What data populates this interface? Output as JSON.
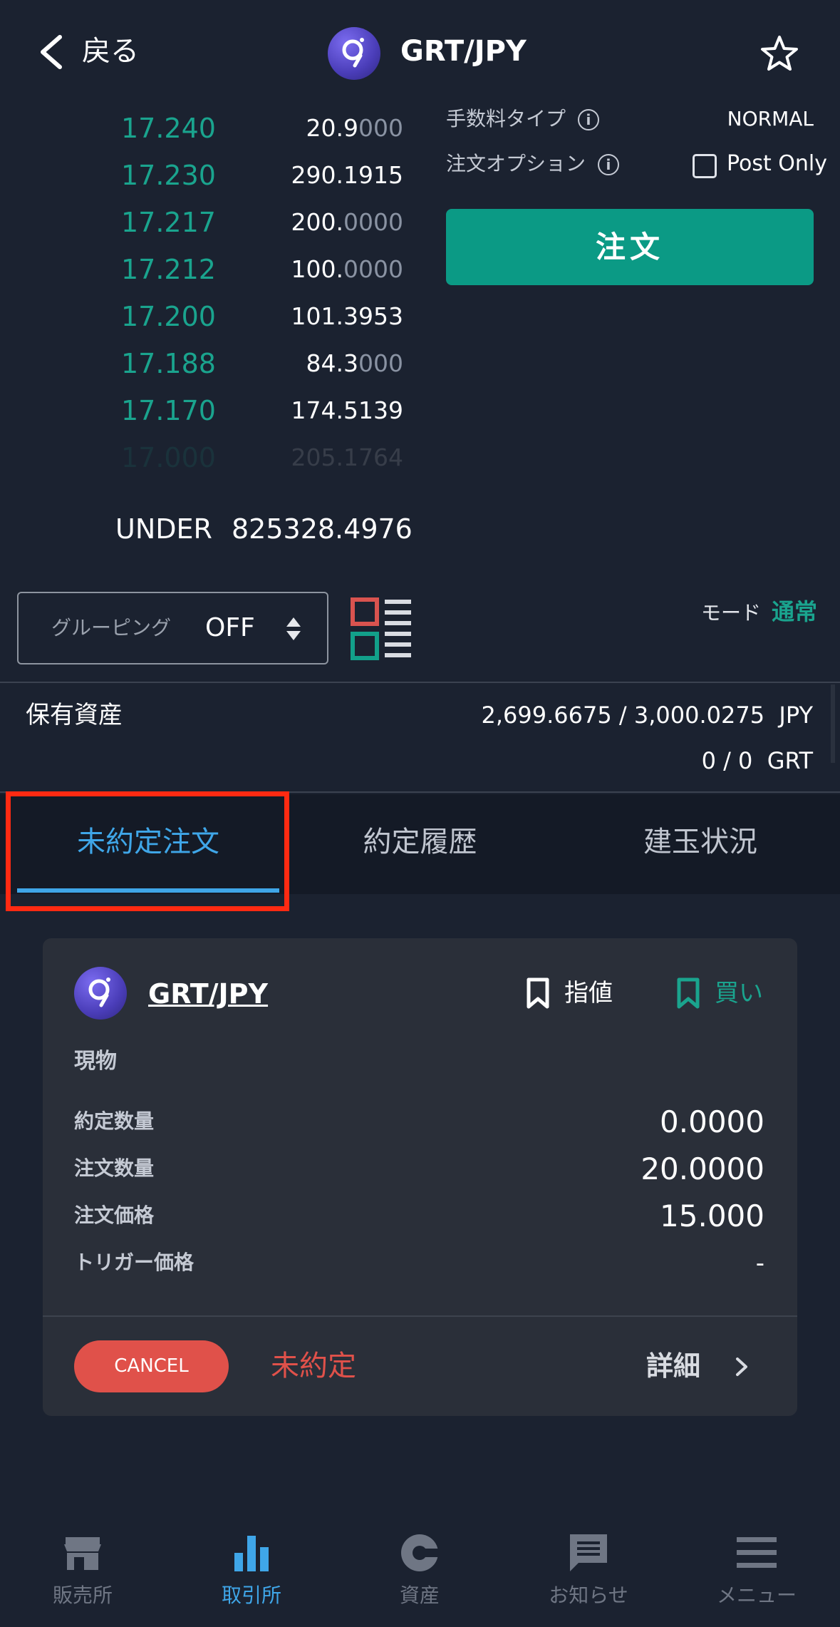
{
  "header": {
    "back_label": "戻る",
    "pair_title": "GRT/JPY"
  },
  "order_book": {
    "rows": [
      {
        "price": "17.240",
        "qty_main": "20.9",
        "qty_dim": "000"
      },
      {
        "price": "17.230",
        "qty_main": "290.1915",
        "qty_dim": ""
      },
      {
        "price": "17.217",
        "qty_main": "200.",
        "qty_dim": "0000"
      },
      {
        "price": "17.212",
        "qty_main": "100.",
        "qty_dim": "0000"
      },
      {
        "price": "17.200",
        "qty_main": "101.3953",
        "qty_dim": ""
      },
      {
        "price": "17.188",
        "qty_main": "84.3",
        "qty_dim": "000"
      },
      {
        "price": "17.170",
        "qty_main": "174.5139",
        "qty_dim": ""
      },
      {
        "price": "17.000",
        "qty_main": "205.1764",
        "qty_dim": ""
      }
    ],
    "under_label": "UNDER",
    "under_value": "825328.4976"
  },
  "order_panel": {
    "fee_type_label": "手数料タイプ",
    "fee_type_value": "NORMAL",
    "order_option_label": "注文オプション",
    "post_only_label": "Post Only",
    "post_only_checked": false,
    "order_button_label": "注文",
    "info_glyph": "i"
  },
  "grouping": {
    "label": "グルーピング",
    "value": "OFF"
  },
  "mode": {
    "label": "モード",
    "value": "通常"
  },
  "assets": {
    "label": "保有資産",
    "jpy_line": "2,699.6675 / 3,000.0275  JPY",
    "grt_line": "0 / 0  GRT"
  },
  "tabs": [
    {
      "label": "未約定注文",
      "active": true
    },
    {
      "label": "約定履歴",
      "active": false
    },
    {
      "label": "建玉状況",
      "active": false
    }
  ],
  "order_card": {
    "pair": "GRT/JPY",
    "order_type": "指値",
    "side": "買い",
    "category": "現物",
    "fields": [
      {
        "label": "約定数量",
        "value": "0.0000"
      },
      {
        "label": "注文数量",
        "value": "20.0000"
      },
      {
        "label": "注文価格",
        "value": "15.000"
      },
      {
        "label": "トリガー価格",
        "value": "-"
      }
    ],
    "cancel_label": "CANCEL",
    "status": "未約定",
    "detail_label": "詳細"
  },
  "bottom_nav": [
    {
      "label": "販売所",
      "icon": "store-icon",
      "active": false
    },
    {
      "label": "取引所",
      "icon": "bar-chart-icon",
      "active": true
    },
    {
      "label": "資産",
      "icon": "pie-chart-icon",
      "active": false
    },
    {
      "label": "お知らせ",
      "icon": "message-icon",
      "active": false
    },
    {
      "label": "メニュー",
      "icon": "menu-icon",
      "active": false
    }
  ],
  "colors": {
    "background": "#1b2230",
    "accent_green": "#1aa48e",
    "accent_blue": "#3fa6e8",
    "cancel_red": "#e0514a",
    "highlight_red": "#ff2a12"
  }
}
